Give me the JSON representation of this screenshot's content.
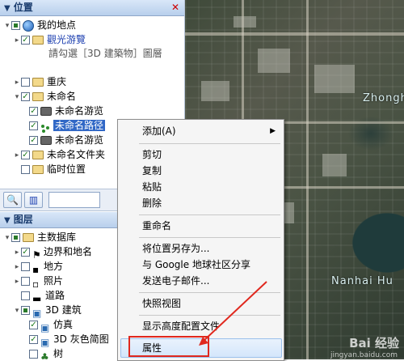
{
  "places_panel": {
    "title": "位置",
    "close": "✕",
    "items": [
      {
        "label": "我的地点"
      },
      {
        "label": "觀光游覽"
      },
      {
        "label": "請勾選［3D 建築物］圖層"
      },
      {
        "label": "重庆"
      },
      {
        "label": "未命名"
      },
      {
        "label": "未命名游览"
      },
      {
        "label": "未命名路径"
      },
      {
        "label": "未命名游览"
      },
      {
        "label": "未命名文件夹"
      },
      {
        "label": "临时位置"
      }
    ]
  },
  "layers_panel": {
    "title": "图层",
    "items": [
      {
        "label": "主数据库"
      },
      {
        "label": "边界和地名"
      },
      {
        "label": "地方"
      },
      {
        "label": "照片"
      },
      {
        "label": "道路"
      },
      {
        "label": "3D 建筑"
      },
      {
        "label": "仿真"
      },
      {
        "label": "3D 灰色简图"
      },
      {
        "label": "树"
      }
    ]
  },
  "map": {
    "labels": [
      "Zhongh",
      "Nanhai Hu"
    ],
    "watermark": "Bai 经验",
    "watermark_url": "jingyan.baidu.com"
  },
  "context_menu": {
    "items": [
      "添加(A)",
      "剪切",
      "复制",
      "粘贴",
      "删除",
      "重命名",
      "将位置另存为...",
      "与 Google 地球社区分享",
      "发送电子邮件...",
      "快照视图",
      "显示高度配置文件",
      "属性"
    ],
    "submenu_arrow": "▶"
  },
  "colors": {
    "selection": "#3168c6",
    "annotation": "#e0281e",
    "panel_header": "#b8cfec"
  }
}
